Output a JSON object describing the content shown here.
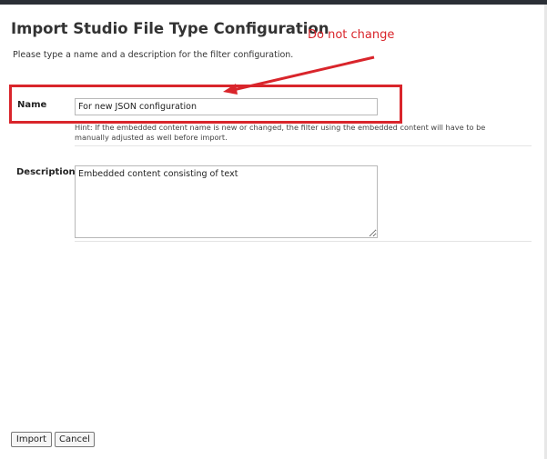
{
  "dialog": {
    "title": "Import Studio File Type Configuration",
    "subtitle": "Please type a name and a description for the filter configuration."
  },
  "annotation": {
    "text": "Do not change",
    "color": "#d9252b"
  },
  "form": {
    "name_label": "Name",
    "name_value": "For new JSON configuration",
    "name_hint": "Hint: If the embedded content name is new or changed, the filter using the embedded content will have to be manually adjusted as well before import.",
    "description_label": "Description",
    "description_value": "Embedded content consisting of text"
  },
  "buttons": {
    "import_label": "Import",
    "cancel_label": "Cancel"
  }
}
